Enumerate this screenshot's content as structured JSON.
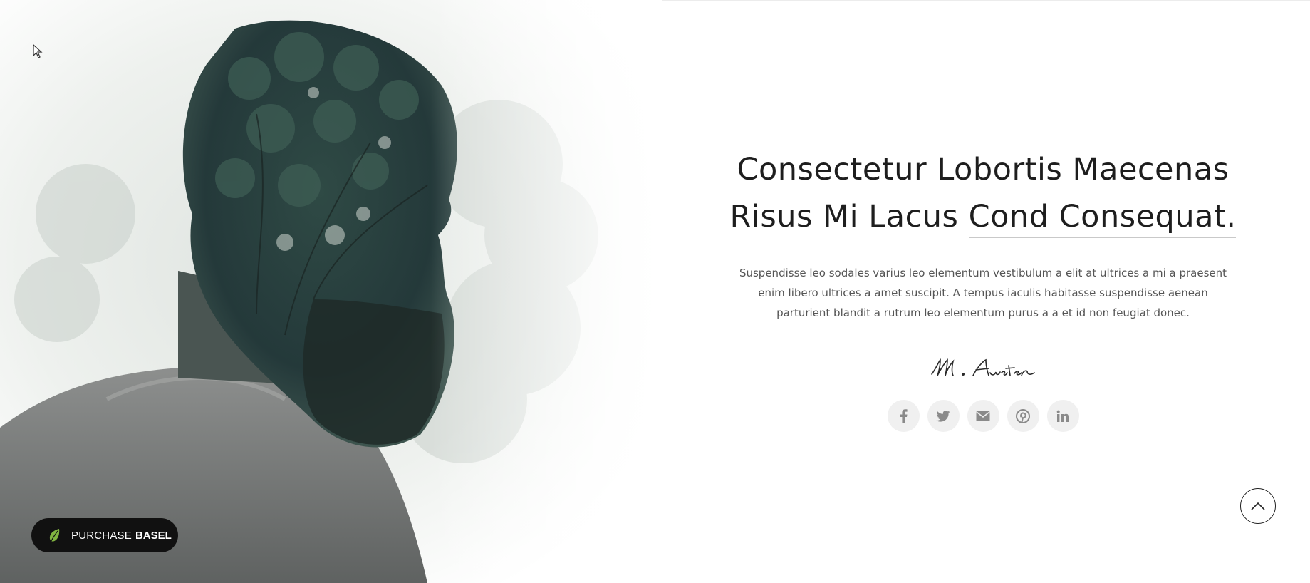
{
  "hero": {
    "title_line1": "Consectetur Lobortis Maecenas",
    "title_line2_part1": "Risus Mi Lacus",
    "title_line2_part2": "Cond Consequat.",
    "description": "Suspendisse leo sodales varius leo elementum vestibulum a elit at ultrices a mi a praesent enim libero ultrices a amet suscipit. A tempus iaculis habitasse suspendisse aenean parturient blandit a rutrum leo elementum purus a a et id non feugiat donec.",
    "signature_text": "M. Austen"
  },
  "social": [
    {
      "name": "facebook",
      "icon": "facebook-icon"
    },
    {
      "name": "twitter",
      "icon": "twitter-icon"
    },
    {
      "name": "email",
      "icon": "envelope-icon"
    },
    {
      "name": "pinterest",
      "icon": "pinterest-icon"
    },
    {
      "name": "linkedin",
      "icon": "linkedin-icon"
    }
  ],
  "purchase": {
    "label": "PURCHASE",
    "label_bold": "BASEL",
    "icon": "envato-leaf-icon"
  },
  "scroll_top": {
    "icon": "chevron-up-icon"
  },
  "colors": {
    "title": "#1e1e1e",
    "body_text": "#555555",
    "social_bg": "#f0f0f0",
    "social_icon": "#8a8a8a",
    "purchase_bg": "#111111",
    "leaf_green": "#81b441"
  }
}
